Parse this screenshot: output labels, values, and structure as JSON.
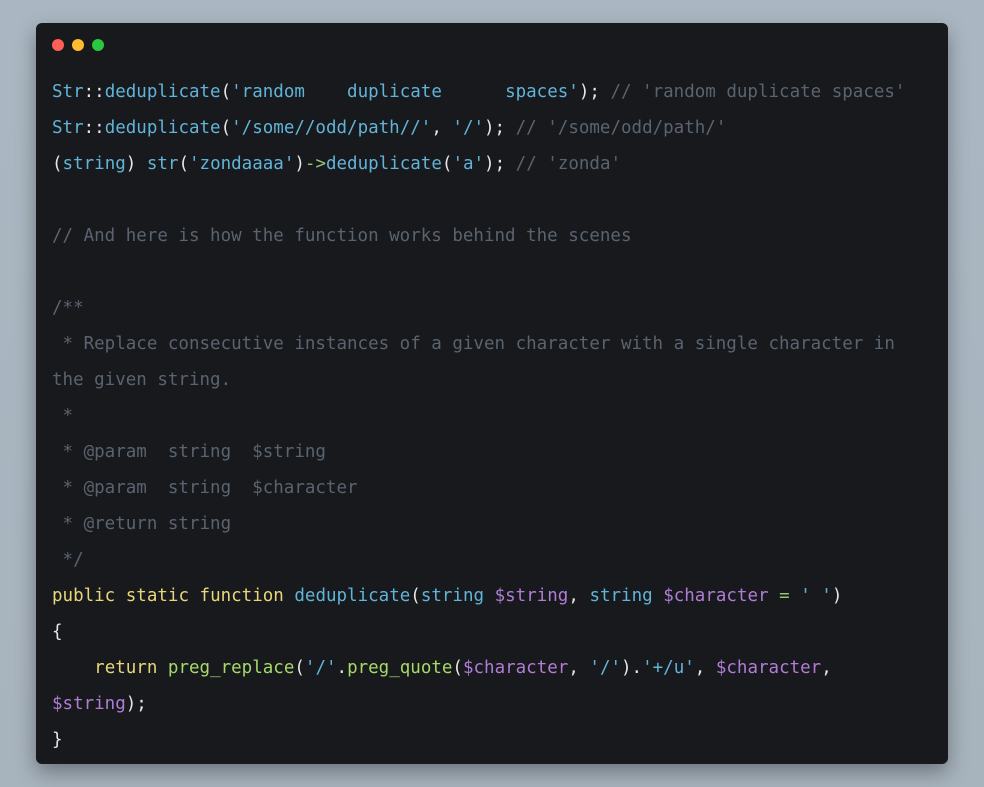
{
  "window": {
    "controls": [
      {
        "name": "close",
        "color": "#ff5f57"
      },
      {
        "name": "minimize",
        "color": "#febc2e"
      },
      {
        "name": "maximize",
        "color": "#28c840"
      }
    ]
  },
  "colors": {
    "background": "#17191c",
    "comment": "#5a6470",
    "keyword": "#e8d77a",
    "identifier": "#61b4d9",
    "variable": "#b07cd6",
    "operator": "#98c379"
  },
  "code": {
    "lines": [
      [
        [
          "cls",
          "Str"
        ],
        [
          "pun",
          "::"
        ],
        [
          "fn",
          "deduplicate"
        ],
        [
          "pun",
          "("
        ],
        [
          "str",
          "'random    duplicate      spaces'"
        ],
        [
          "pun",
          ");"
        ],
        [
          "pun",
          " "
        ],
        [
          "cmt",
          "// 'random duplicate spaces'"
        ]
      ],
      [
        [
          "cls",
          "Str"
        ],
        [
          "pun",
          "::"
        ],
        [
          "fn",
          "deduplicate"
        ],
        [
          "pun",
          "("
        ],
        [
          "str",
          "'/some//odd/path//'"
        ],
        [
          "pun",
          ", "
        ],
        [
          "str",
          "'/'"
        ],
        [
          "pun",
          ");"
        ],
        [
          "pun",
          " "
        ],
        [
          "cmt",
          "// '/some/odd/path/'"
        ]
      ],
      [
        [
          "pun",
          "("
        ],
        [
          "type",
          "string"
        ],
        [
          "pun",
          ") "
        ],
        [
          "fn",
          "str"
        ],
        [
          "pun",
          "("
        ],
        [
          "str",
          "'zondaaaa'"
        ],
        [
          "pun",
          ")"
        ],
        [
          "op",
          "->"
        ],
        [
          "fn",
          "deduplicate"
        ],
        [
          "pun",
          "("
        ],
        [
          "str",
          "'a'"
        ],
        [
          "pun",
          ");"
        ],
        [
          "pun",
          " "
        ],
        [
          "cmt",
          "// 'zonda'"
        ]
      ],
      [],
      [
        [
          "cmt",
          "// And here is how the function works behind the scenes"
        ]
      ],
      [],
      [
        [
          "cmt",
          "/**"
        ]
      ],
      [
        [
          "cmt",
          " * Replace consecutive instances of a given character with a single character in"
        ]
      ],
      [
        [
          "cmt",
          "the given string."
        ]
      ],
      [
        [
          "cmt",
          " *"
        ]
      ],
      [
        [
          "cmt",
          " * @param  string  $string"
        ]
      ],
      [
        [
          "cmt",
          " * @param  string  $character"
        ]
      ],
      [
        [
          "cmt",
          " * @return string"
        ]
      ],
      [
        [
          "cmt",
          " */"
        ]
      ],
      [
        [
          "kw",
          "public"
        ],
        [
          "pun",
          " "
        ],
        [
          "kw",
          "static"
        ],
        [
          "pun",
          " "
        ],
        [
          "kw",
          "function"
        ],
        [
          "pun",
          " "
        ],
        [
          "fn",
          "deduplicate"
        ],
        [
          "pun",
          "("
        ],
        [
          "type",
          "string"
        ],
        [
          "pun",
          " "
        ],
        [
          "var",
          "$string"
        ],
        [
          "pun",
          ", "
        ],
        [
          "type",
          "string"
        ],
        [
          "pun",
          " "
        ],
        [
          "var",
          "$character"
        ],
        [
          "pun",
          " "
        ],
        [
          "op",
          "="
        ],
        [
          "pun",
          " "
        ],
        [
          "str",
          "' '"
        ],
        [
          "pun",
          ")"
        ]
      ],
      [
        [
          "pun",
          "{"
        ]
      ],
      [
        [
          "pun",
          "    "
        ],
        [
          "kw",
          "return"
        ],
        [
          "pun",
          " "
        ],
        [
          "fn2",
          "preg_replace"
        ],
        [
          "pun",
          "("
        ],
        [
          "str",
          "'/'"
        ],
        [
          "pun",
          "."
        ],
        [
          "fn2",
          "preg_quote"
        ],
        [
          "pun",
          "("
        ],
        [
          "var",
          "$character"
        ],
        [
          "pun",
          ", "
        ],
        [
          "str",
          "'/'"
        ],
        [
          "pun",
          ")."
        ],
        [
          "str",
          "'+/u'"
        ],
        [
          "pun",
          ", "
        ],
        [
          "var",
          "$character"
        ],
        [
          "pun",
          ","
        ]
      ],
      [
        [
          "var",
          "$string"
        ],
        [
          "pun",
          ");"
        ]
      ],
      [
        [
          "pun",
          "}"
        ]
      ]
    ]
  }
}
